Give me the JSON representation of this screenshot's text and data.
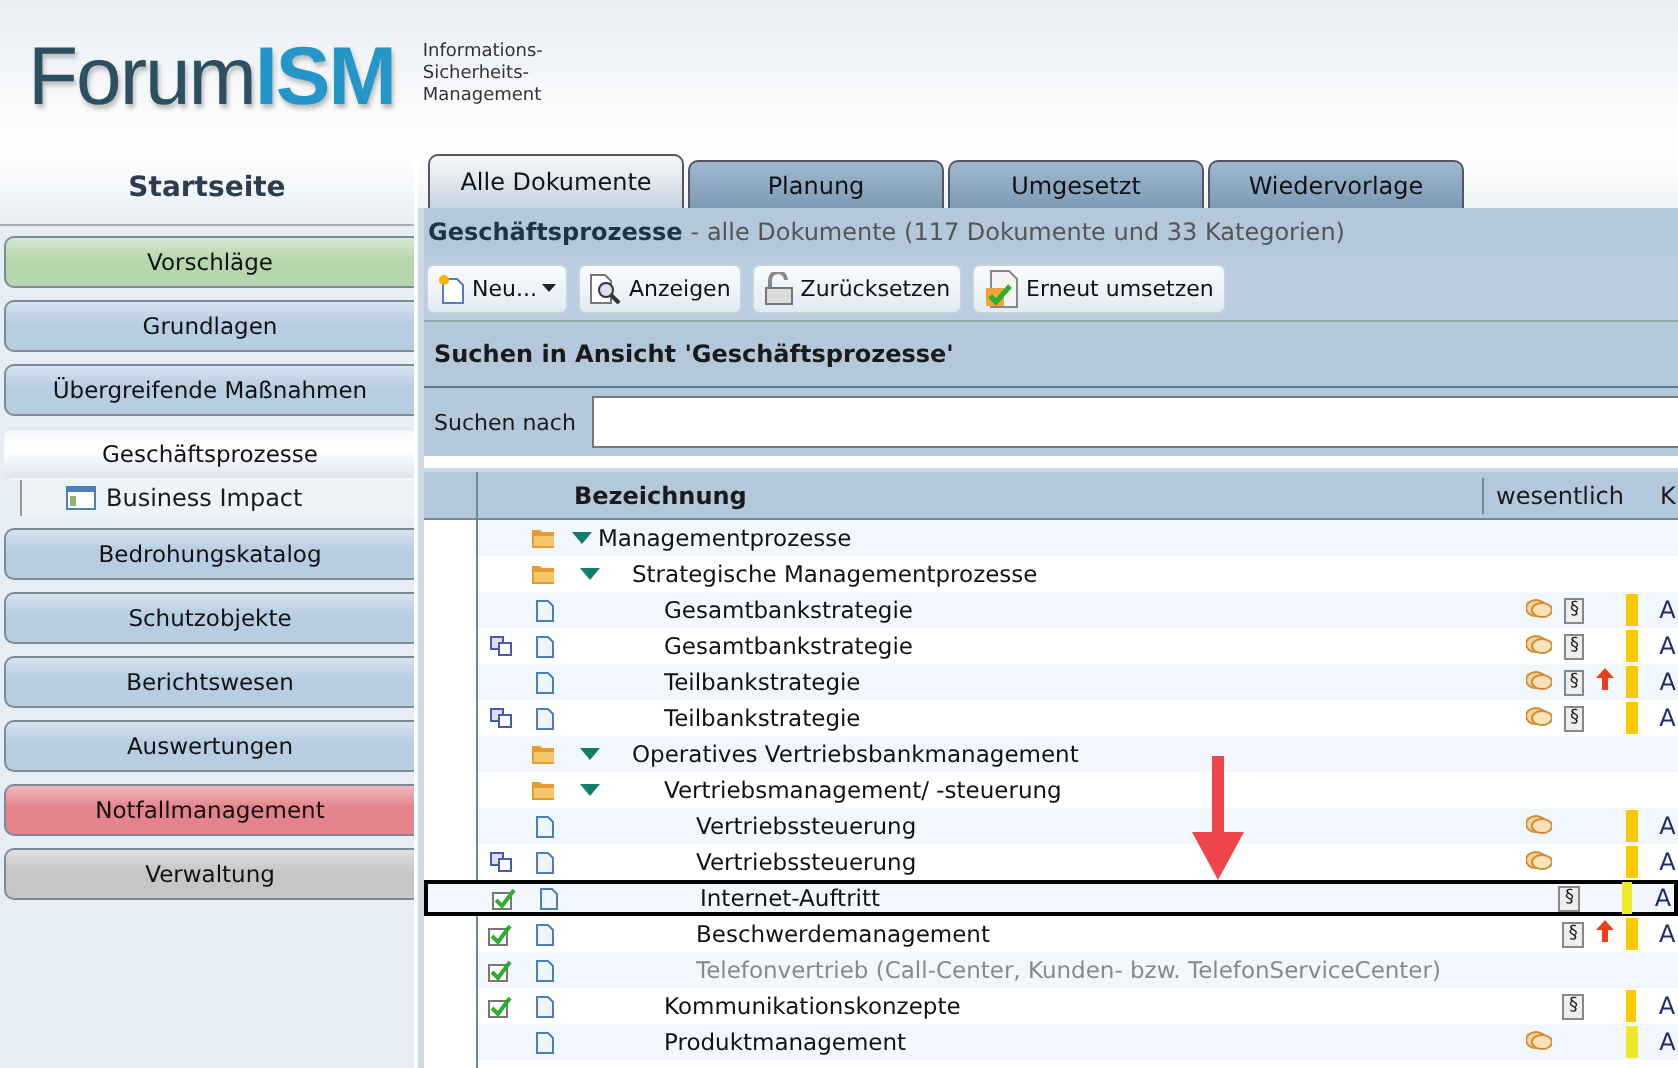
{
  "logo": {
    "name_part1": "Forum",
    "name_part2": "ISM",
    "tagline": [
      "Informations-",
      "Sicherheits-",
      "Management"
    ]
  },
  "sidebar": {
    "title": "Startseite",
    "items": [
      {
        "label": "Vorschläge",
        "selected": false,
        "color": "#b6d7ad"
      },
      {
        "label": "Grundlagen",
        "selected": false,
        "color": "#b7cde2"
      },
      {
        "label": "Übergreifende Maßnahmen",
        "selected": false,
        "color": "#b7cde2"
      },
      {
        "label": "Geschäftsprozesse",
        "selected": true,
        "children": [
          {
            "label": "Business Impact"
          }
        ]
      },
      {
        "label": "Bedrohungskatalog",
        "selected": false,
        "color": "#b7cde2"
      },
      {
        "label": "Schutzobjekte",
        "selected": false,
        "color": "#b7cde2"
      },
      {
        "label": "Berichtswesen",
        "selected": false,
        "color": "#b7cde2"
      },
      {
        "label": "Auswertungen",
        "selected": false,
        "color": "#b7cde2"
      },
      {
        "label": "Notfallmanagement",
        "selected": false,
        "color": "#e5838c"
      },
      {
        "label": "Verwaltung",
        "selected": false,
        "color": "#c6c6c6"
      }
    ]
  },
  "tabs": [
    {
      "label": "Alle Dokumente",
      "selected": true
    },
    {
      "label": "Planung",
      "selected": false
    },
    {
      "label": "Umgesetzt",
      "selected": false
    },
    {
      "label": "Wiedervorlage",
      "selected": false
    }
  ],
  "view": {
    "title": "Geschäftsprozesse",
    "subtitle": "- alle Dokumente (117 Dokumente und 33 Kategorien)"
  },
  "toolbar": [
    {
      "label": "Neu...",
      "kind": "new"
    },
    {
      "label": "Anzeigen",
      "kind": "show"
    },
    {
      "label": "Zurücksetzen",
      "kind": "reset"
    },
    {
      "label": "Erneut umsetzen",
      "kind": "redo"
    }
  ],
  "search": {
    "title": "Suchen in Ansicht 'Geschäftsprozesse'",
    "label": "Suchen nach"
  },
  "table": {
    "columns": [
      "Bezeichnung",
      "wesentlich",
      "K"
    ],
    "rows": [
      {
        "label": "Managementprozesse",
        "kind": "folder",
        "expanded": true,
        "children": [
          {
            "label": "Strategische Managementprozesse",
            "kind": "folder",
            "expanded": true,
            "children": [
              {
                "label": "Gesamtbankstrategie",
                "kind": "document",
                "essential": true,
                "paragraph": "§",
                "raised": false,
                "color": "#fcc800",
                "column_3": "A"
              },
              {
                "label": "Gesamtbankstrategie",
                "kind": "document",
                "copied": true,
                "essential": true,
                "paragraph": "§",
                "raised": false,
                "color": "#fcc800",
                "column_3": "A"
              },
              {
                "label": "Teilbankstrategie",
                "kind": "document",
                "essential": true,
                "paragraph": "§",
                "raised": true,
                "color": "#fcc800",
                "column_3": "A"
              },
              {
                "label": "Teilbankstrategie",
                "kind": "document",
                "copied": true,
                "essential": true,
                "paragraph": "§",
                "raised": false,
                "color": "#fcc800",
                "column_3": "A"
              }
            ]
          },
          {
            "label": "Operatives Vertriebsbankmanagement",
            "kind": "folder",
            "expanded": true,
            "children": [
              {
                "label": "Vertriebsmanagement/ -steuerung",
                "kind": "folder",
                "expanded": true,
                "children": [
                  {
                    "label": "Vertriebssteuerung",
                    "kind": "document",
                    "essential": true,
                    "raised": false,
                    "color": "#fcc800",
                    "column_3": "A"
                  },
                  {
                    "label": "Vertriebssteuerung",
                    "kind": "document",
                    "copied": true,
                    "essential": true,
                    "raised": false,
                    "color": "#fcc800",
                    "column_3": "A"
                  },
                  {
                    "label": "Internet-Auftritt",
                    "kind": "document",
                    "checked": true,
                    "selected": true,
                    "essential": false,
                    "paragraph": "§",
                    "raised": false,
                    "color": "#eeea2a",
                    "column_3": "A"
                  },
                  {
                    "label": "Beschwerdemanagement",
                    "kind": "document",
                    "checked": true,
                    "essential": false,
                    "paragraph": "§",
                    "raised": true,
                    "color": "#fcc800",
                    "column_3": "A"
                  },
                  {
                    "label": "Telefonvertrieb (Call-Center, Kunden- bzw. TelefonServiceCenter)",
                    "kind": "document",
                    "checked": true,
                    "disabled": true
                  }
                ]
              },
              {
                "label": "Kommunikationskonzepte",
                "kind": "document",
                "checked": true,
                "essential": false,
                "paragraph": "§",
                "raised": false,
                "color": "#fcc800",
                "column_3": "A"
              },
              {
                "label": "Produktmanagement",
                "kind": "document",
                "essential": true,
                "raised": false,
                "color": "#eeea2a",
                "column_3": "A"
              }
            ]
          }
        ]
      }
    ]
  }
}
